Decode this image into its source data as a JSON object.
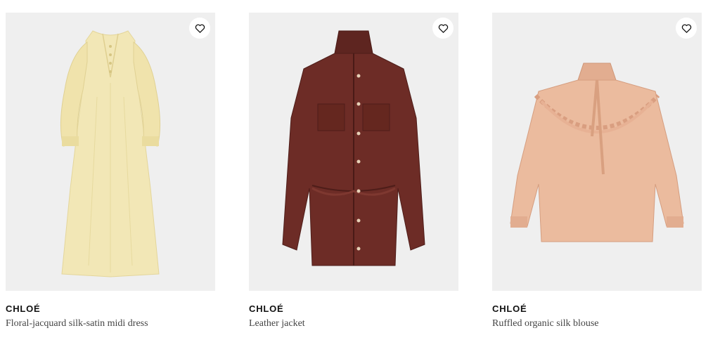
{
  "products": [
    {
      "brand": "CHLOÉ",
      "name": "Floral-jacquard silk-satin midi dress",
      "color": "#f1e6b5",
      "image_icon": "dress-image",
      "wishlist_icon": "heart-icon"
    },
    {
      "brand": "CHLOÉ",
      "name": "Leather jacket",
      "color": "#6b2b25",
      "image_icon": "jacket-image",
      "wishlist_icon": "heart-icon"
    },
    {
      "brand": "CHLOÉ",
      "name": "Ruffled organic silk blouse",
      "color": "#e9b79a",
      "image_icon": "blouse-image",
      "wishlist_icon": "heart-icon"
    }
  ]
}
